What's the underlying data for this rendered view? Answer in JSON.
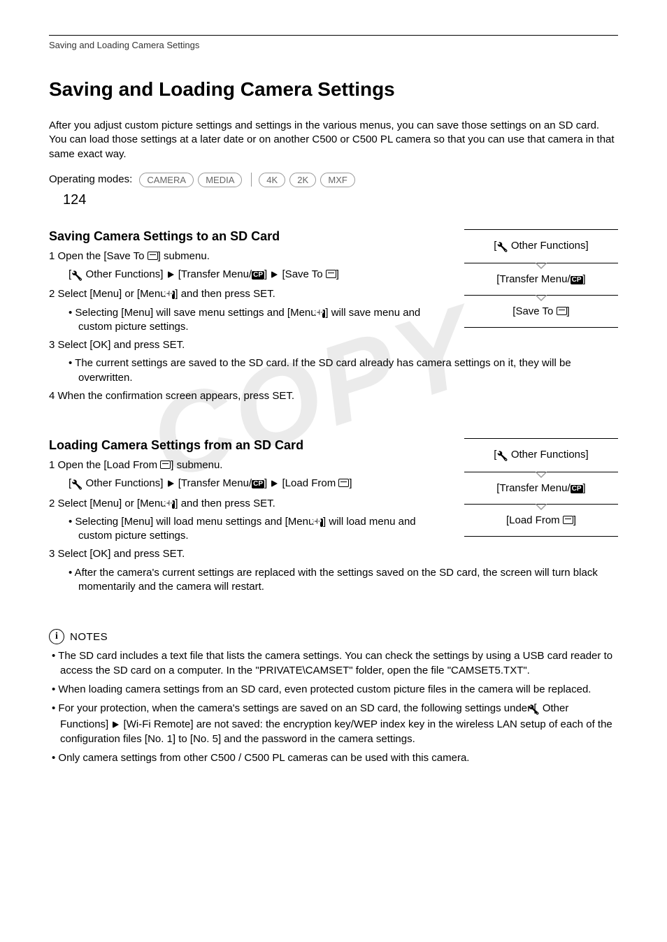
{
  "running_head": "Saving and Loading Camera Settings",
  "page_number": "124",
  "heading": "Saving and Loading Camera Settings",
  "intro": "After you adjust custom picture settings and settings in the various menus, you can save those settings on an SD card. You can load those settings at a later date or on another C500 or C500 PL camera so that you can use that camera in that same exact way.",
  "op_modes_label": "Operating modes:",
  "modes": {
    "m1": "CAMERA",
    "m2": "MEDIA",
    "m3": "4K",
    "m4": "2K",
    "m5": "MXF"
  },
  "save": {
    "title": "Saving Camera Settings to an SD Card",
    "step1_a": "1 Open the [Save To ",
    "step1_b": "] submenu.",
    "path_of_a": "Other Functions]",
    "path_tm_a": "[Transfer Menu/",
    "path_tm_b": "]",
    "path_st_a": "[Save To ",
    "path_st_b": "]",
    "step2_a": "2 Select [Menu] or [Menu+",
    "step2_b": "] and then press SET.",
    "sub2_a": "Selecting [Menu] will save menu settings and [Menu+",
    "sub2_b": "] will save menu and custom picture settings.",
    "step3": "3 Select [OK] and press SET.",
    "sub3": "The current settings are saved to the SD card. If the SD card already has camera settings on it, they will be overwritten.",
    "step4": "4 When the confirmation screen appears, press SET.",
    "menu1": "Other Functions]",
    "menu2_a": "[Transfer Menu/",
    "menu2_b": "]",
    "menu3_a": "[Save To ",
    "menu3_b": "]"
  },
  "load": {
    "title": "Loading Camera Settings from an SD Card",
    "step1_a": "1 Open the [Load From ",
    "step1_b": "] submenu.",
    "path_of_a": "Other Functions]",
    "path_tm_a": "[Transfer Menu/",
    "path_tm_b": "]",
    "path_lf_a": "[Load From ",
    "path_lf_b": "]",
    "step2_a": "2 Select [Menu] or [Menu+",
    "step2_b": "] and then press SET.",
    "sub2_a": "Selecting [Menu] will load menu settings and [Menu+",
    "sub2_b": "] will load menu and custom picture settings.",
    "step3": "3 Select [OK] and press SET.",
    "sub3": "After the camera's current settings are replaced with the settings saved on the SD card, the screen will turn black momentarily and the camera will restart.",
    "menu1": "Other Functions]",
    "menu2_a": "[Transfer Menu/",
    "menu2_b": "]",
    "menu3_a": "[Load From ",
    "menu3_b": "]"
  },
  "notes_label": "NOTES",
  "notes": {
    "n1": "The SD card includes a text file that lists the camera settings. You can check the settings by using a USB card reader to access the SD card on a computer. In the \"PRIVATE\\CAMSET\" folder, open the file \"CAMSET5.TXT\".",
    "n2": "When loading camera settings from an SD card, even protected custom picture files in the camera will be replaced.",
    "n3_a": "For your protection, when the camera's settings are saved on an SD card, the following settings under [",
    "n3_b": " Other Functions] ",
    "n3_c": " [Wi-Fi Remote] are not saved: the encryption key/WEP index key in the wireless LAN setup of each of the configuration files [No. 1] to [No. 5] and the password in the camera settings.",
    "n4": "Only camera settings from other C500 / C500 PL cameras can be used with this camera."
  },
  "watermark": "COPY"
}
